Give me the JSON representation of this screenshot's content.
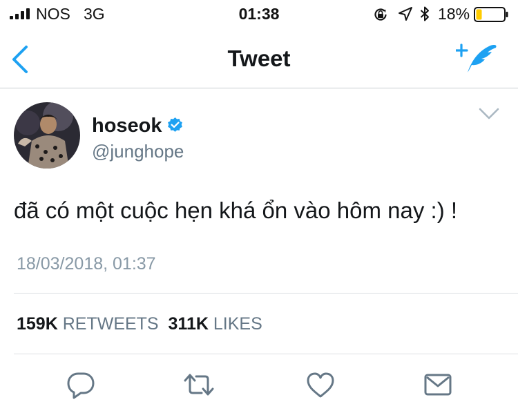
{
  "status_bar": {
    "carrier": "NOS",
    "network": "3G",
    "time": "01:38",
    "battery_percent": "18%",
    "battery_level": 0.18
  },
  "nav": {
    "title": "Tweet"
  },
  "tweet": {
    "author": {
      "name": "hoseok",
      "handle": "@junghope",
      "verified": true
    },
    "text": "đã có một cuộc hẹn khá ổn vào hôm nay :) !",
    "timestamp": "18/03/2018, 01:37",
    "stats": {
      "retweets_count": "159K",
      "retweets_label": "RETWEETS",
      "likes_count": "311K",
      "likes_label": "LIKES"
    }
  },
  "colors": {
    "accent": "#1da1f2",
    "battery_fill": "#ffcc00",
    "secondary_text": "#657786"
  },
  "icons": [
    "signal-icon",
    "screen-lock-icon",
    "location-arrow-icon",
    "bluetooth-icon",
    "battery-icon",
    "back-chevron-icon",
    "compose-tweet-icon",
    "verified-badge-icon",
    "chevron-down-icon",
    "reply-icon",
    "retweet-icon",
    "like-icon",
    "direct-message-icon"
  ]
}
